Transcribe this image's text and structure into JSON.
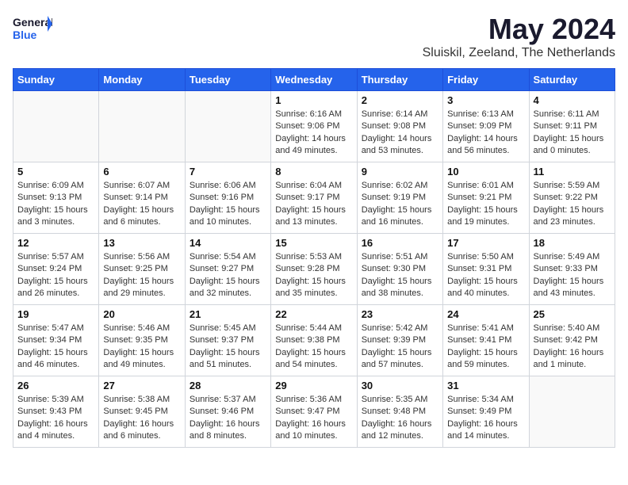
{
  "header": {
    "logo_general": "General",
    "logo_blue": "Blue",
    "month": "May 2024",
    "location": "Sluiskil, Zeeland, The Netherlands"
  },
  "weekdays": [
    "Sunday",
    "Monday",
    "Tuesday",
    "Wednesday",
    "Thursday",
    "Friday",
    "Saturday"
  ],
  "weeks": [
    [
      {
        "day": "",
        "info": ""
      },
      {
        "day": "",
        "info": ""
      },
      {
        "day": "",
        "info": ""
      },
      {
        "day": "1",
        "info": "Sunrise: 6:16 AM\nSunset: 9:06 PM\nDaylight: 14 hours\nand 49 minutes."
      },
      {
        "day": "2",
        "info": "Sunrise: 6:14 AM\nSunset: 9:08 PM\nDaylight: 14 hours\nand 53 minutes."
      },
      {
        "day": "3",
        "info": "Sunrise: 6:13 AM\nSunset: 9:09 PM\nDaylight: 14 hours\nand 56 minutes."
      },
      {
        "day": "4",
        "info": "Sunrise: 6:11 AM\nSunset: 9:11 PM\nDaylight: 15 hours\nand 0 minutes."
      }
    ],
    [
      {
        "day": "5",
        "info": "Sunrise: 6:09 AM\nSunset: 9:13 PM\nDaylight: 15 hours\nand 3 minutes."
      },
      {
        "day": "6",
        "info": "Sunrise: 6:07 AM\nSunset: 9:14 PM\nDaylight: 15 hours\nand 6 minutes."
      },
      {
        "day": "7",
        "info": "Sunrise: 6:06 AM\nSunset: 9:16 PM\nDaylight: 15 hours\nand 10 minutes."
      },
      {
        "day": "8",
        "info": "Sunrise: 6:04 AM\nSunset: 9:17 PM\nDaylight: 15 hours\nand 13 minutes."
      },
      {
        "day": "9",
        "info": "Sunrise: 6:02 AM\nSunset: 9:19 PM\nDaylight: 15 hours\nand 16 minutes."
      },
      {
        "day": "10",
        "info": "Sunrise: 6:01 AM\nSunset: 9:21 PM\nDaylight: 15 hours\nand 19 minutes."
      },
      {
        "day": "11",
        "info": "Sunrise: 5:59 AM\nSunset: 9:22 PM\nDaylight: 15 hours\nand 23 minutes."
      }
    ],
    [
      {
        "day": "12",
        "info": "Sunrise: 5:57 AM\nSunset: 9:24 PM\nDaylight: 15 hours\nand 26 minutes."
      },
      {
        "day": "13",
        "info": "Sunrise: 5:56 AM\nSunset: 9:25 PM\nDaylight: 15 hours\nand 29 minutes."
      },
      {
        "day": "14",
        "info": "Sunrise: 5:54 AM\nSunset: 9:27 PM\nDaylight: 15 hours\nand 32 minutes."
      },
      {
        "day": "15",
        "info": "Sunrise: 5:53 AM\nSunset: 9:28 PM\nDaylight: 15 hours\nand 35 minutes."
      },
      {
        "day": "16",
        "info": "Sunrise: 5:51 AM\nSunset: 9:30 PM\nDaylight: 15 hours\nand 38 minutes."
      },
      {
        "day": "17",
        "info": "Sunrise: 5:50 AM\nSunset: 9:31 PM\nDaylight: 15 hours\nand 40 minutes."
      },
      {
        "day": "18",
        "info": "Sunrise: 5:49 AM\nSunset: 9:33 PM\nDaylight: 15 hours\nand 43 minutes."
      }
    ],
    [
      {
        "day": "19",
        "info": "Sunrise: 5:47 AM\nSunset: 9:34 PM\nDaylight: 15 hours\nand 46 minutes."
      },
      {
        "day": "20",
        "info": "Sunrise: 5:46 AM\nSunset: 9:35 PM\nDaylight: 15 hours\nand 49 minutes."
      },
      {
        "day": "21",
        "info": "Sunrise: 5:45 AM\nSunset: 9:37 PM\nDaylight: 15 hours\nand 51 minutes."
      },
      {
        "day": "22",
        "info": "Sunrise: 5:44 AM\nSunset: 9:38 PM\nDaylight: 15 hours\nand 54 minutes."
      },
      {
        "day": "23",
        "info": "Sunrise: 5:42 AM\nSunset: 9:39 PM\nDaylight: 15 hours\nand 57 minutes."
      },
      {
        "day": "24",
        "info": "Sunrise: 5:41 AM\nSunset: 9:41 PM\nDaylight: 15 hours\nand 59 minutes."
      },
      {
        "day": "25",
        "info": "Sunrise: 5:40 AM\nSunset: 9:42 PM\nDaylight: 16 hours\nand 1 minute."
      }
    ],
    [
      {
        "day": "26",
        "info": "Sunrise: 5:39 AM\nSunset: 9:43 PM\nDaylight: 16 hours\nand 4 minutes."
      },
      {
        "day": "27",
        "info": "Sunrise: 5:38 AM\nSunset: 9:45 PM\nDaylight: 16 hours\nand 6 minutes."
      },
      {
        "day": "28",
        "info": "Sunrise: 5:37 AM\nSunset: 9:46 PM\nDaylight: 16 hours\nand 8 minutes."
      },
      {
        "day": "29",
        "info": "Sunrise: 5:36 AM\nSunset: 9:47 PM\nDaylight: 16 hours\nand 10 minutes."
      },
      {
        "day": "30",
        "info": "Sunrise: 5:35 AM\nSunset: 9:48 PM\nDaylight: 16 hours\nand 12 minutes."
      },
      {
        "day": "31",
        "info": "Sunrise: 5:34 AM\nSunset: 9:49 PM\nDaylight: 16 hours\nand 14 minutes."
      },
      {
        "day": "",
        "info": ""
      }
    ]
  ]
}
